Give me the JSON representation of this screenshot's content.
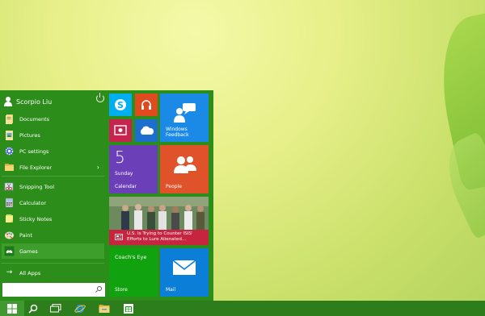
{
  "start_menu": {
    "user_name": "Scorpio Liu",
    "items": [
      {
        "label": "Documents"
      },
      {
        "label": "Pictures"
      },
      {
        "label": "PC settings"
      },
      {
        "label": "File Explorer"
      },
      {
        "label": "Snipping Tool"
      },
      {
        "label": "Calculator"
      },
      {
        "label": "Sticky Notes"
      },
      {
        "label": "Paint"
      },
      {
        "label": "Games"
      }
    ],
    "all_apps_label": "All Apps",
    "search": {
      "value": "",
      "placeholder": ""
    }
  },
  "tiles": {
    "windows_feedback": "Windows Feedback",
    "calendar_day": "5",
    "calendar_weekday": "Sunday",
    "calendar_label": "Calendar",
    "people_label": "People",
    "news_headline": "U.S. Is Trying to Counter ISIS' Efforts to Lure Alienated...",
    "coachs_eye": "Coach's Eye",
    "store_label": "Store",
    "mail_label": "Mail"
  },
  "colors": {
    "menu_bg": "#2d8d1b",
    "taskbar_bg": "#2e7d1d",
    "skype": "#00aff0",
    "music": "#e04a1f",
    "video": "#c7234f",
    "onedrive": "#1c6fcf",
    "feedback": "#1b8ae6",
    "calendar": "#6b3fb8",
    "people": "#e0522a",
    "news": "#c6243f",
    "store": "#10a20f",
    "mail": "#0b7ed8"
  },
  "taskbar": {
    "icons": [
      "windows-logo-icon",
      "search-icon",
      "task-view-icon",
      "internet-explorer-icon",
      "file-explorer-icon",
      "store-icon"
    ]
  }
}
